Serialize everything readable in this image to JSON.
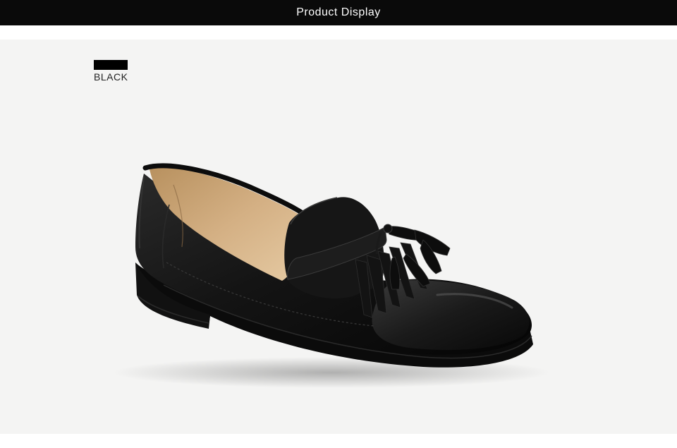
{
  "header": {
    "title": "Product Display"
  },
  "product": {
    "color_swatch": "#000000",
    "color_name": "BLACK",
    "image_description_icon": "black-tassel-loafer"
  },
  "colors": {
    "header_bg": "#0a0a0a",
    "panel_bg": "#f4f4f3",
    "leather": "#111111",
    "lining": "#c9a277"
  }
}
